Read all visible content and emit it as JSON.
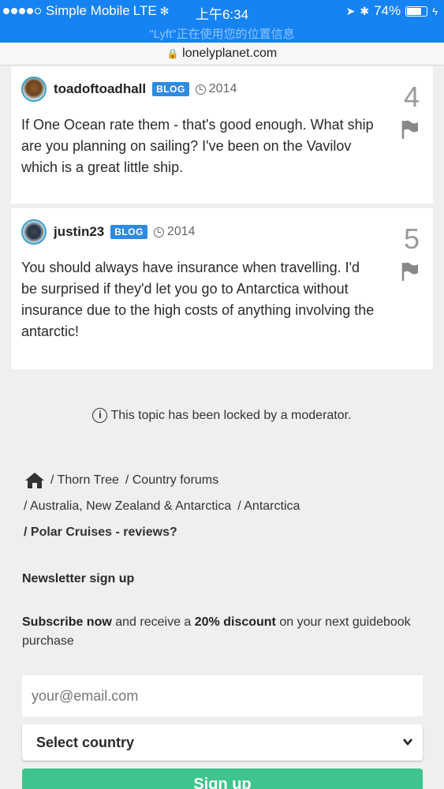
{
  "status_bar": {
    "carrier": "Simple Mobile",
    "network": "LTE",
    "time": "上午6:34",
    "battery": "74%",
    "battery_level": 0.74,
    "notice": "\"Lyft\"正在使用您的位置信息"
  },
  "url_bar": {
    "domain": "lonelyplanet.com"
  },
  "posts": [
    {
      "username": "toadoftoadhall",
      "badge": "BLOG",
      "year": "2014",
      "number": "4",
      "body": "If One Ocean rate them - that's good enough. What ship are you planning on sailing? I've been on the Vavilov which is a great little ship."
    },
    {
      "username": "justin23",
      "badge": "BLOG",
      "year": "2014",
      "number": "5",
      "body": "You should always have insurance when travelling. I'd be surprised if they'd let you go to Antarctica without insurance due to the high costs of anything involving the antarctic!"
    }
  ],
  "locked_notice": "This topic has been locked by a moderator.",
  "breadcrumbs": {
    "items": [
      "/ Thorn Tree",
      "/ Country forums",
      "/ Australia, New Zealand & Antarctica",
      "/ Antarctica",
      "/ Polar Cruises - reviews?"
    ]
  },
  "newsletter": {
    "title": "Newsletter sign up",
    "subscribe_bold": "Subscribe now",
    "text_mid": " and receive a ",
    "discount": "20% discount",
    "text_end": " on your next guidebook purchase",
    "email_placeholder": "your@email.com",
    "country_select": "Select country",
    "signup_label": "Sign up"
  },
  "colors": {
    "status_bar": "#1683f3",
    "badge": "#2e8be0",
    "signup": "#3ec48c"
  }
}
